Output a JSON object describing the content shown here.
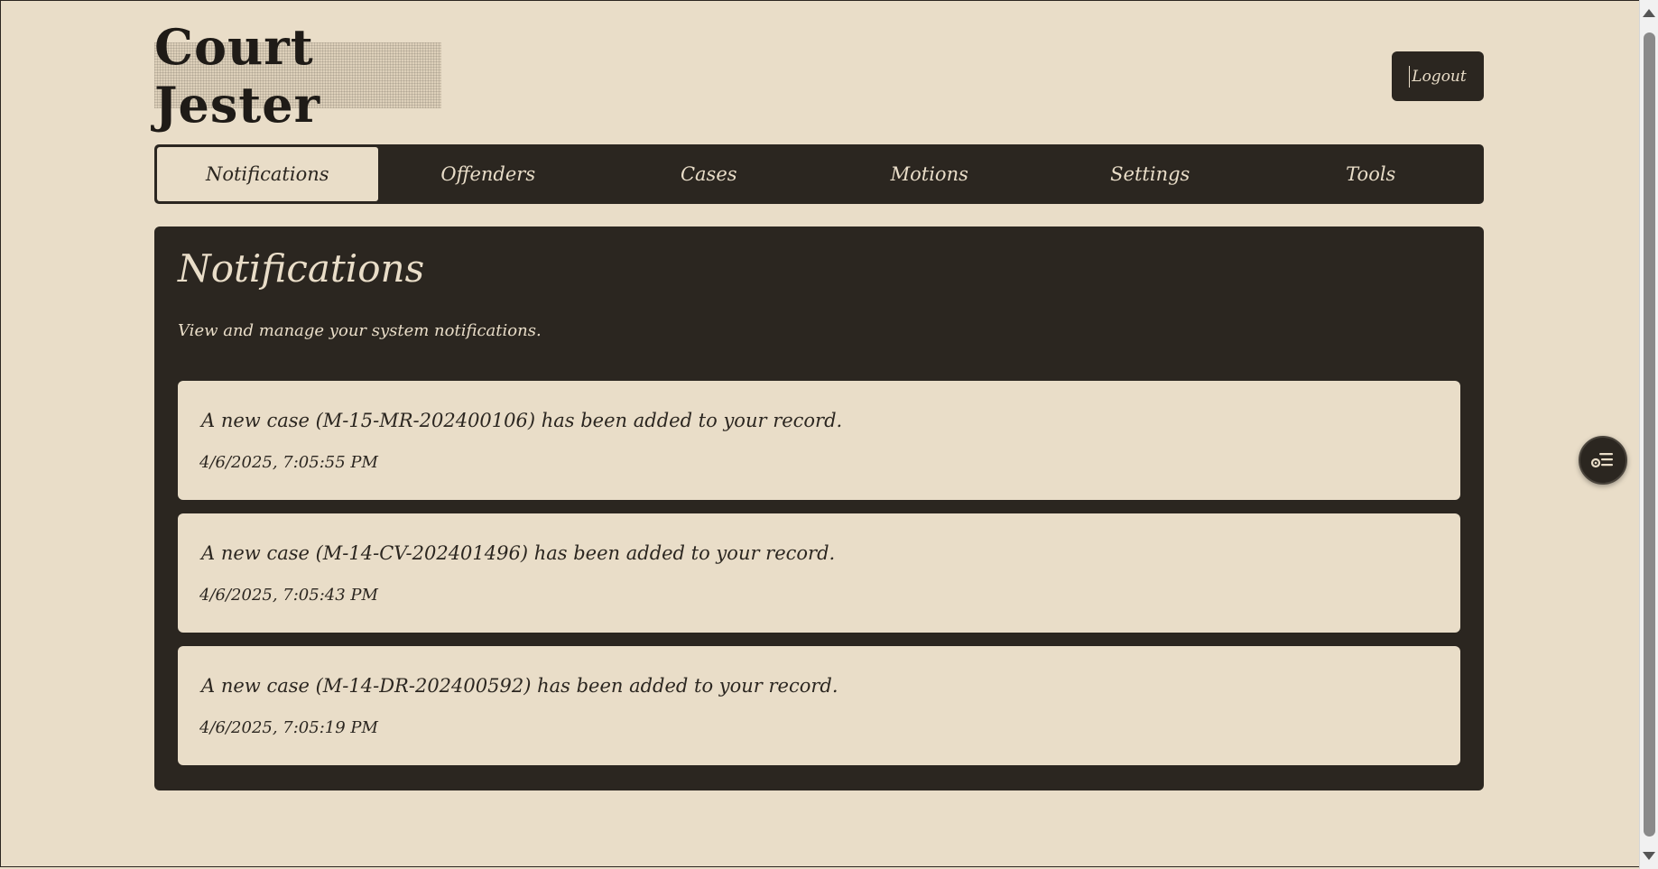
{
  "app": {
    "logo_text": "Court Jester",
    "logout_label": "Logout"
  },
  "nav": {
    "tabs": [
      "Notifications",
      "Offenders",
      "Cases",
      "Motions",
      "Settings",
      "Tools"
    ],
    "active": "Notifications"
  },
  "page": {
    "title": "Notifications",
    "subtitle": "View and manage your system notifications."
  },
  "notifications": [
    {
      "message": "A new case (M-15-MR-202400106) has been added to your record.",
      "time": "4/6/2025, 7:05:55 PM"
    },
    {
      "message": "A new case (M-14-CV-202401496) has been added to your record.",
      "time": "4/6/2025, 7:05:43 PM"
    },
    {
      "message": "A new case (M-14-DR-202400592) has been added to your record.",
      "time": "4/6/2025, 7:05:19 PM"
    }
  ],
  "floating_button": {
    "icon": "list-settings-icon"
  },
  "colors": {
    "background": "#e9ddc8",
    "dark": "#2b2620"
  }
}
